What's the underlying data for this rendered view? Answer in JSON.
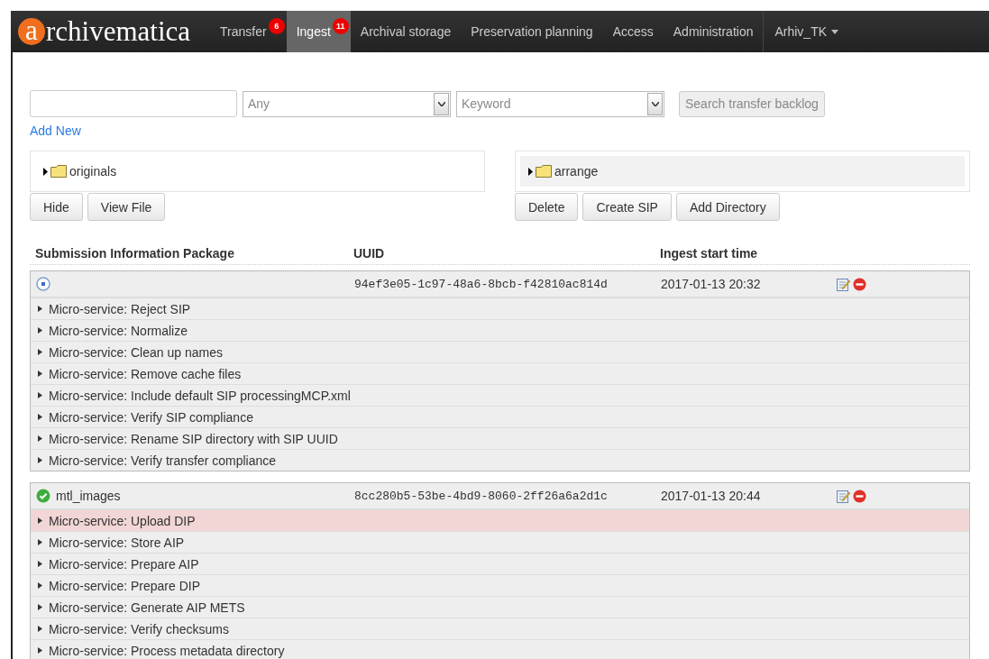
{
  "nav": {
    "logo": "archivematica",
    "items": [
      {
        "label": "Transfer",
        "selected": false,
        "badge": "6"
      },
      {
        "label": "Ingest",
        "selected": true,
        "badge": "11"
      },
      {
        "label": "Archival storage",
        "selected": false
      },
      {
        "label": "Preservation planning",
        "selected": false
      },
      {
        "label": "Access",
        "selected": false
      },
      {
        "label": "Administration",
        "selected": false
      }
    ],
    "user": "Arhiv_TK"
  },
  "search": {
    "field_type": "Any",
    "query_type": "Keyword",
    "button": "Search transfer backlog",
    "add_new": "Add New"
  },
  "trees": [
    {
      "folder": "originals",
      "buttons": [
        "Hide",
        "View File"
      ]
    },
    {
      "folder": "arrange",
      "buttons": [
        "Delete",
        "Create SIP",
        "Add Directory"
      ]
    }
  ],
  "table": {
    "columns": [
      "Submission Information Package",
      "UUID",
      "Ingest start time"
    ],
    "packages": [
      {
        "kind": "processing",
        "uuid": "94ef3e05-1c97-48a6-8bcb-f42810ac814d",
        "time": "2017-01-13 20:32",
        "jobs": [
          {
            "label": "Micro-service: Reject SIP",
            "awaiting": false
          },
          {
            "label": "Micro-service: Normalize",
            "awaiting": false
          },
          {
            "label": "Micro-service: Clean up names",
            "awaiting": false
          },
          {
            "label": "Micro-service: Remove cache files",
            "awaiting": false
          },
          {
            "label": "Micro-service: Include default SIP processingMCP.xml",
            "awaiting": false
          },
          {
            "label": "Micro-service: Verify SIP compliance",
            "awaiting": false
          },
          {
            "label": "Micro-service: Rename SIP directory with SIP UUID",
            "awaiting": false
          },
          {
            "label": "Micro-service: Verify transfer compliance",
            "awaiting": false
          }
        ]
      },
      {
        "name": "mtl_images",
        "kind": "done",
        "uuid": "8cc280b5-53be-4bd9-8060-2ff26a6a2d1c",
        "time": "2017-01-13 20:44",
        "jobs": [
          {
            "label": "Micro-service: Upload DIP",
            "awaiting": true
          },
          {
            "label": "Micro-service: Store AIP",
            "awaiting": false
          },
          {
            "label": "Micro-service: Prepare AIP",
            "awaiting": false
          },
          {
            "label": "Micro-service: Prepare DIP",
            "awaiting": false
          },
          {
            "label": "Micro-service: Generate AIP METS",
            "awaiting": false
          },
          {
            "label": "Micro-service: Verify checksums",
            "awaiting": false
          },
          {
            "label": "Micro-service: Process metadata directory",
            "awaiting": false
          }
        ]
      }
    ]
  }
}
